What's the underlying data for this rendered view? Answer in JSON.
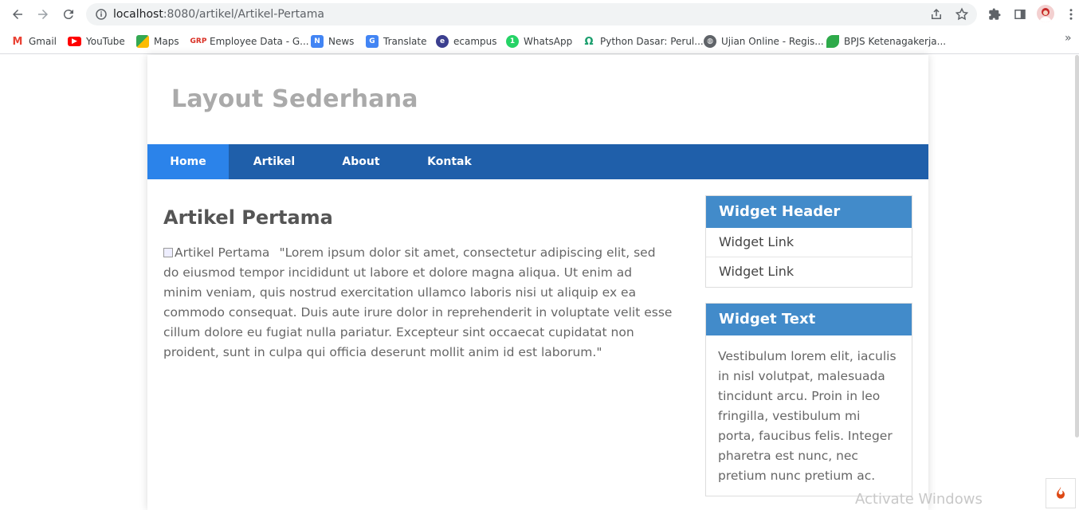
{
  "browser": {
    "url_host": "localhost",
    "url_rest": ":8080/artikel/Artikel-Pertama"
  },
  "bookmarks": [
    {
      "label": "Gmail",
      "icon": "gmail-icon",
      "color": "#ea4335"
    },
    {
      "label": "YouTube",
      "icon": "youtube-icon",
      "color": "#ff0000"
    },
    {
      "label": "Maps",
      "icon": "maps-icon",
      "color": "#34a853"
    },
    {
      "label": "Employee Data - G...",
      "icon": "grp-icon",
      "color": "#d93025"
    },
    {
      "label": "News",
      "icon": "news-icon",
      "color": "#4285f4"
    },
    {
      "label": "Translate",
      "icon": "translate-icon",
      "color": "#4285f4"
    },
    {
      "label": "ecampus",
      "icon": "ecampus-icon",
      "color": "#3b3f8f"
    },
    {
      "label": "WhatsApp",
      "icon": "whatsapp-icon",
      "color": "#25d366"
    },
    {
      "label": "Python Dasar: Perul...",
      "icon": "python-icon",
      "color": "#1a9e6d"
    },
    {
      "label": "Ujian Online - Regis...",
      "icon": "globe-icon",
      "color": "#5f6368"
    },
    {
      "label": "BPJS Ketenagakerja...",
      "icon": "bpjs-icon",
      "color": "#2eaa4a"
    }
  ],
  "site": {
    "title": "Layout Sederhana",
    "nav": [
      "Home",
      "Artikel",
      "About",
      "Kontak"
    ],
    "active_nav": "Home"
  },
  "article": {
    "title": "Artikel Pertama",
    "image_alt": "Artikel Pertama",
    "body": "\"Lorem ipsum dolor sit amet, consectetur adipiscing elit, sed do eiusmod tempor incididunt ut labore et dolore magna aliqua. Ut enim ad minim veniam, quis nostrud exercitation ullamco laboris nisi ut aliquip ex ea commodo consequat. Duis aute irure dolor in reprehenderit in voluptate velit esse cillum dolore eu fugiat nulla pariatur. Excepteur sint occaecat cupidatat non proident, sunt in culpa qui officia deserunt mollit anim id est laborum.\""
  },
  "sidebar": {
    "widget1": {
      "header": "Widget Header",
      "links": [
        "Widget Link",
        "Widget Link"
      ]
    },
    "widget2": {
      "header": "Widget Text",
      "text": "Vestibulum lorem elit, iaculis in nisl volutpat, malesuada tincidunt arcu. Proin in leo fringilla, vestibulum mi porta, faucibus felis. Integer pharetra est nunc, nec pretium nunc pretium ac."
    }
  },
  "os": {
    "watermark": "Activate Windows"
  },
  "colors": {
    "nav_bg": "#1f5faa",
    "nav_active": "#2b83ea",
    "widget_header": "#428bca"
  }
}
